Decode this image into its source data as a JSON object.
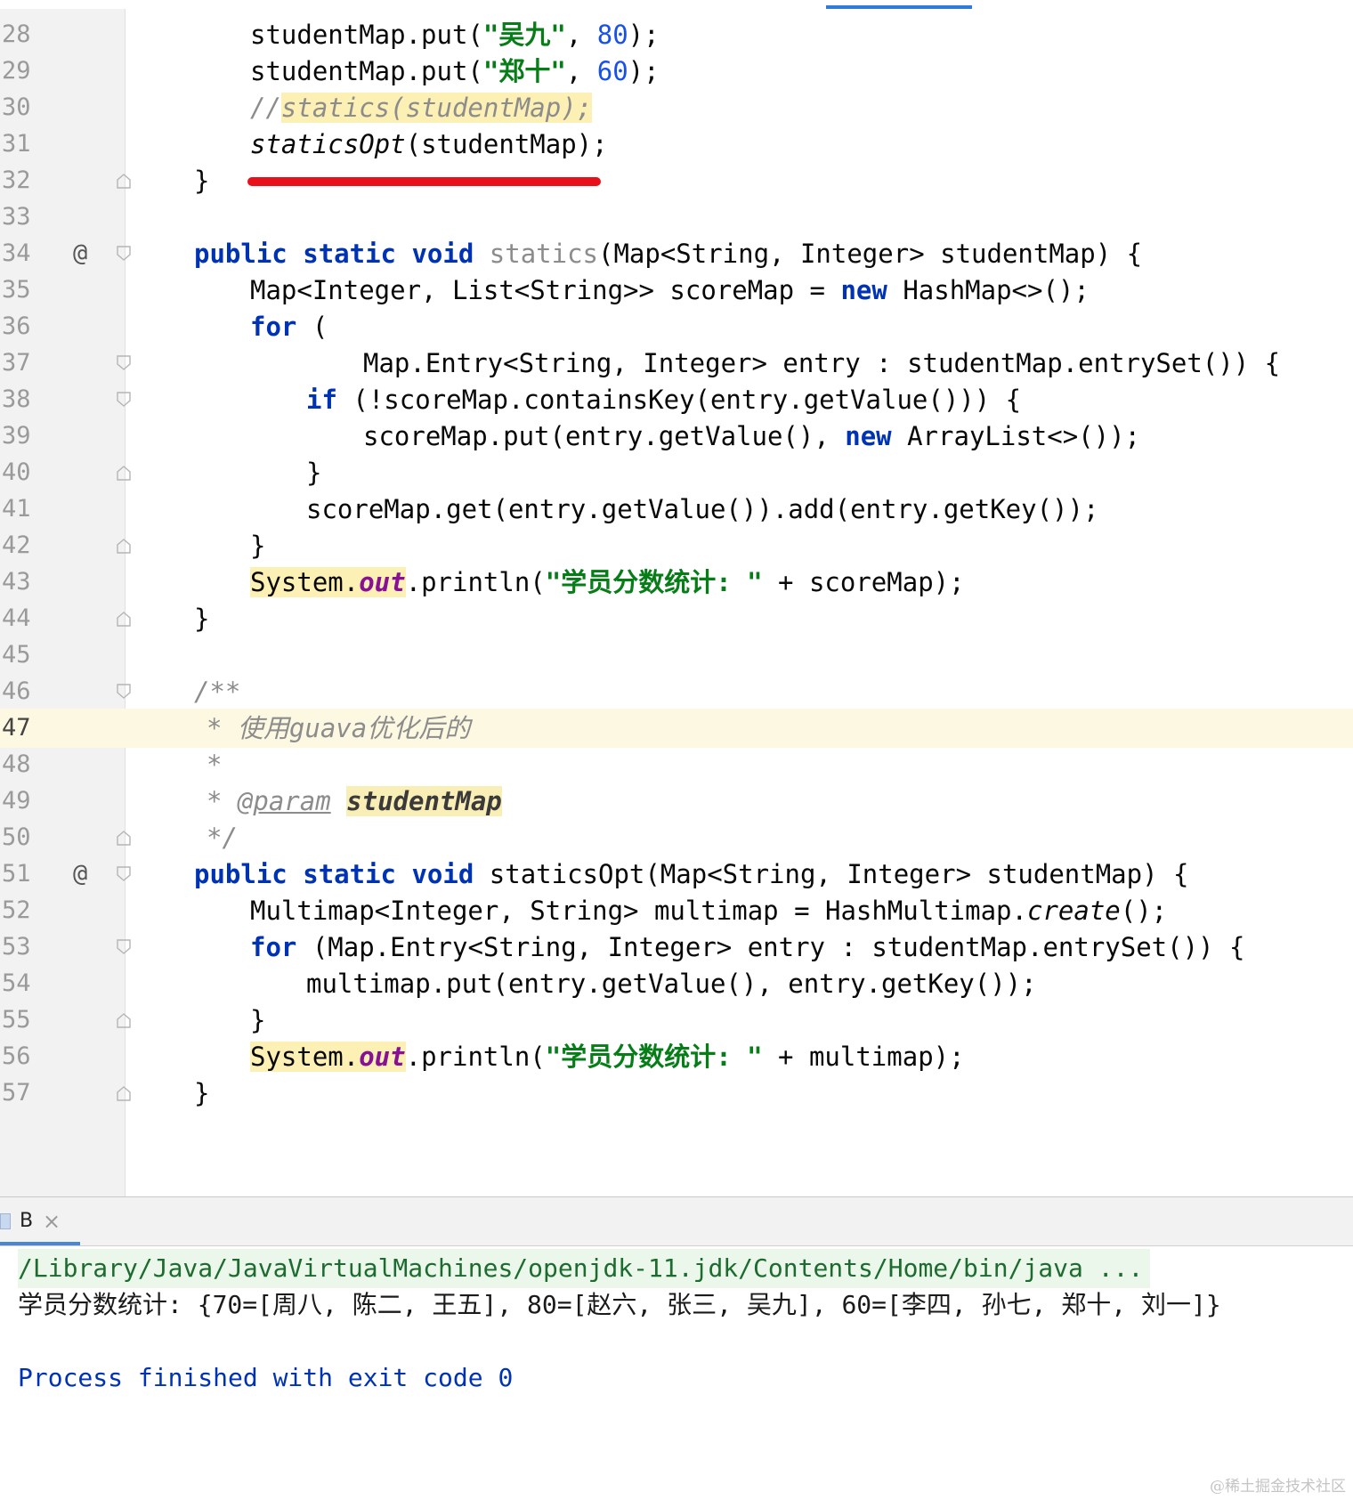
{
  "editor": {
    "current_line": "47",
    "lines": {
      "l28": {
        "number": "28",
        "pre": "studentMap.put(",
        "str": "\"吴九\"",
        "mid": ", ",
        "num": "80",
        "post": ");"
      },
      "l29": {
        "number": "29",
        "pre": "studentMap.put(",
        "str": "\"郑十\"",
        "mid": ", ",
        "num": "60",
        "post": ");"
      },
      "l30": {
        "number": "30",
        "comment_slashes": "//",
        "comment_body": "statics(studentMap);"
      },
      "l31": {
        "number": "31",
        "method": "staticsOpt",
        "args": "(studentMap);"
      },
      "l32": {
        "number": "32",
        "text": "}"
      },
      "l33": {
        "number": "33"
      },
      "l34": {
        "number": "34",
        "gutter_mark": "@",
        "kw1": "public",
        "kw2": "static",
        "kw3": "void",
        "method": "statics",
        "rest": "(Map<String, Integer> studentMap) {"
      },
      "l35": {
        "number": "35",
        "pre": "Map<Integer, List<String>> scoreMap = ",
        "kw": "new",
        "post": " HashMap<>();"
      },
      "l36": {
        "number": "36",
        "kw": "for",
        "post": " ("
      },
      "l37": {
        "number": "37",
        "text": "Map.Entry<String, Integer> entry : studentMap.entrySet()) {"
      },
      "l38": {
        "number": "38",
        "kw": "if",
        "post": " (!scoreMap.containsKey(entry.getValue())) {"
      },
      "l39": {
        "number": "39",
        "pre": "scoreMap.put(entry.getValue(), ",
        "kw": "new",
        "post": " ArrayList<>());"
      },
      "l40": {
        "number": "40",
        "text": "}"
      },
      "l41": {
        "number": "41",
        "text": "scoreMap.get(entry.getValue()).add(entry.getKey());"
      },
      "l42": {
        "number": "42",
        "text": "}"
      },
      "l43": {
        "number": "43",
        "sys": "System.",
        "field": "out",
        "mid": ".println(",
        "str": "\"学员分数统计: \"",
        "post": " + scoreMap);"
      },
      "l44": {
        "number": "44",
        "text": "}"
      },
      "l45": {
        "number": "45"
      },
      "l46": {
        "number": "46",
        "text": "/**"
      },
      "l47": {
        "number": "47",
        "text": "* 使用guava优化后的"
      },
      "l48": {
        "number": "48",
        "text": "*"
      },
      "l49": {
        "number": "49",
        "star": "* ",
        "tag": "@param",
        "param": "studentMap"
      },
      "l50": {
        "number": "50",
        "text": "*/"
      },
      "l51": {
        "number": "51",
        "gutter_mark": "@",
        "kw1": "public",
        "kw2": "static",
        "kw3": "void",
        "rest": "staticsOpt(Map<String, Integer> studentMap) {"
      },
      "l52": {
        "number": "52",
        "pre": "Multimap<Integer, String> multimap = HashMultimap.",
        "ital": "create",
        "post": "();"
      },
      "l53": {
        "number": "53",
        "kw": "for",
        "post": " (Map.Entry<String, Integer> entry : studentMap.entrySet()) {"
      },
      "l54": {
        "number": "54",
        "text": "multimap.put(entry.getValue(), entry.getKey());"
      },
      "l55": {
        "number": "55",
        "text": "}"
      },
      "l56": {
        "number": "56",
        "sys": "System.",
        "field": "out",
        "mid": ".println(",
        "str": "\"学员分数统计: \"",
        "post": " + multimap);"
      },
      "l57": {
        "number": "57",
        "text": "}"
      }
    }
  },
  "run_panel": {
    "tab_label": "B",
    "tab_close": "×",
    "console": {
      "java_path": "/Library/Java/JavaVirtualMachines/openjdk-11.jdk/Contents/Home/bin/java ...",
      "output": "学员分数统计: {70=[周八, 陈二, 王五], 80=[赵六, 张三, 吴九], 60=[李四, 孙七, 郑十, 刘一]}",
      "exit_message": "Process finished with exit code 0"
    }
  },
  "watermark": "@稀土掘金技术社区",
  "colors": {
    "keyword": "#0033b3",
    "string": "#067d17",
    "number": "#1750eb",
    "comment": "#8c8c8c",
    "annotation_underline": "#e8101a",
    "current_line": "#fdf8e1"
  }
}
